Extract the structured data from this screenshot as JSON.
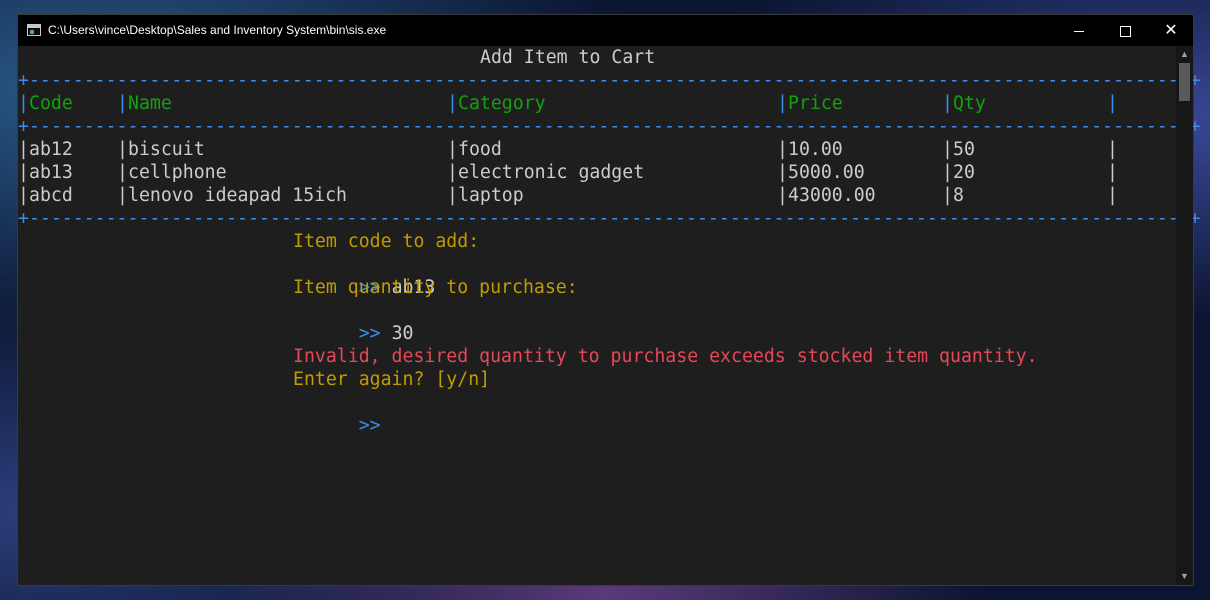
{
  "window": {
    "title": "C:\\Users\\vince\\Desktop\\Sales and Inventory System\\bin\\sis.exe",
    "minimize_glyph": "",
    "close_glyph": "✕"
  },
  "console": {
    "heading": "Add Item to Cart",
    "separator": "+----------------------------------------------------------------------------------------------------------+",
    "columns": [
      "Code",
      "Name",
      "Category",
      "Price",
      "Qty"
    ],
    "rows": [
      {
        "code": "ab12",
        "name": "biscuit",
        "category": "food",
        "price": "10.00",
        "qty": "50"
      },
      {
        "code": "ab13",
        "name": "cellphone",
        "category": "electronic gadget",
        "price": "5000.00",
        "qty": "20"
      },
      {
        "code": "abcd",
        "name": "lenovo ideapad 15ich",
        "category": "laptop",
        "price": "43000.00",
        "qty": "8"
      }
    ],
    "prompt_code_label": "Item code to add:",
    "prompt_marker": ">>",
    "input_code": "ab13",
    "prompt_qty_label": "Item quantity to purchase:",
    "input_qty": "30",
    "error_message": "Invalid, desired quantity to purchase exceeds stocked item quantity.",
    "retry_prompt": "Enter again? [y/n]",
    "retry_input": ""
  },
  "colors": {
    "border": "#3b8eea",
    "header_text": "#13a10e",
    "prompt_text": "#c19c00",
    "error_text": "#e74856",
    "background": "#1e1e1e"
  }
}
